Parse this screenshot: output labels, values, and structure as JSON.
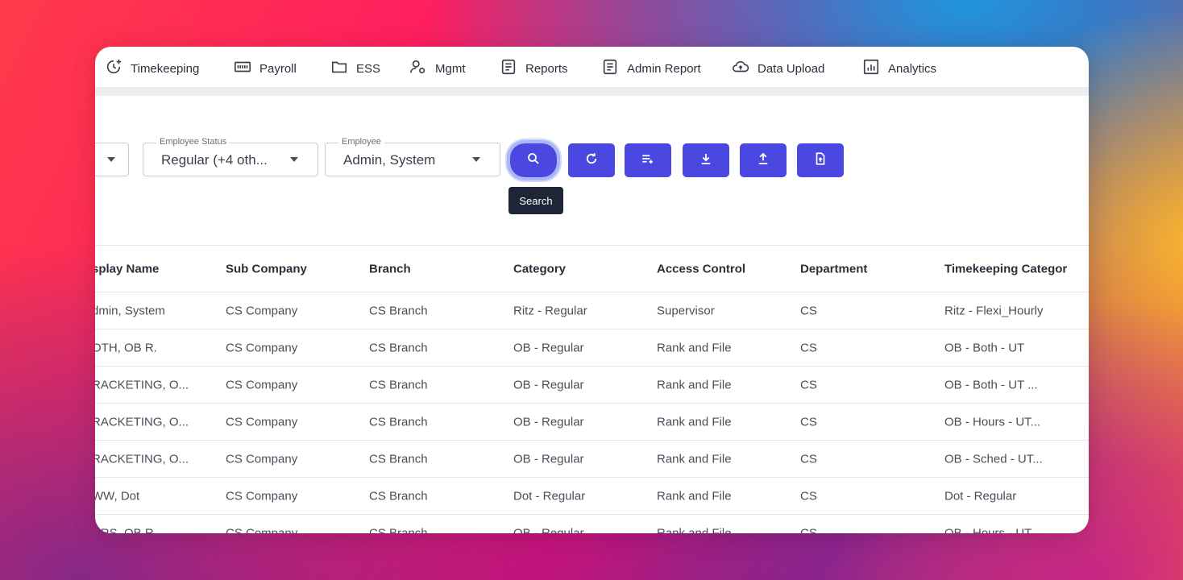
{
  "nav": {
    "items": [
      {
        "label": "Timekeeping",
        "icon": "timekeeping-icon"
      },
      {
        "label": "Payroll",
        "icon": "payroll-icon"
      },
      {
        "label": "ESS",
        "icon": "folder-icon"
      },
      {
        "label": "Mgmt",
        "icon": "user-gear-icon"
      },
      {
        "label": "Reports",
        "icon": "document-icon"
      },
      {
        "label": "Admin Report",
        "icon": "document-icon"
      },
      {
        "label": "Data Upload",
        "icon": "cloud-upload-icon"
      },
      {
        "label": "Analytics",
        "icon": "chart-icon"
      }
    ]
  },
  "filters": {
    "employee_status": {
      "legend": "Employee Status",
      "value": "Regular (+4 oth..."
    },
    "employee": {
      "legend": "Employee",
      "value": "Admin, System"
    }
  },
  "buttons": {
    "search_tooltip": "Search",
    "icons": [
      "search-icon",
      "refresh-icon",
      "add-list-icon",
      "download-icon",
      "upload-icon",
      "file-upload-icon"
    ]
  },
  "colors": {
    "accent": "#4a48e0",
    "tooltip_bg": "#1e2536"
  },
  "table": {
    "columns": [
      "splay Name",
      "Sub Company",
      "Branch",
      "Category",
      "Access Control",
      "Department",
      "Timekeeping Categor"
    ],
    "rows": [
      [
        "dmin, System",
        "CS Company",
        "CS Branch",
        "Ritz - Regular",
        "Supervisor",
        "CS",
        "Ritz - Flexi_Hourly"
      ],
      [
        "OTH, OB R.",
        "CS Company",
        "CS Branch",
        "OB - Regular",
        "Rank and File",
        "CS",
        "OB - Both - UT"
      ],
      [
        "RACKETING, O...",
        "CS Company",
        "CS Branch",
        "OB - Regular",
        "Rank and File",
        "CS",
        "OB - Both - UT ..."
      ],
      [
        "RACKETING, O...",
        "CS Company",
        "CS Branch",
        "OB - Regular",
        "Rank and File",
        "CS",
        "OB - Hours - UT..."
      ],
      [
        "RACKETING, O...",
        "CS Company",
        "CS Branch",
        "OB - Regular",
        "Rank and File",
        "CS",
        "OB - Sched - UT..."
      ],
      [
        "WW, Dot",
        "CS Company",
        "CS Branch",
        "Dot - Regular",
        "Rank and File",
        "CS",
        "Dot - Regular"
      ],
      [
        "URS, OB R.",
        "CS Company",
        "CS Branch",
        "OB - Regular",
        "Rank and File",
        "CS",
        "OB - Hours - UT"
      ]
    ]
  }
}
